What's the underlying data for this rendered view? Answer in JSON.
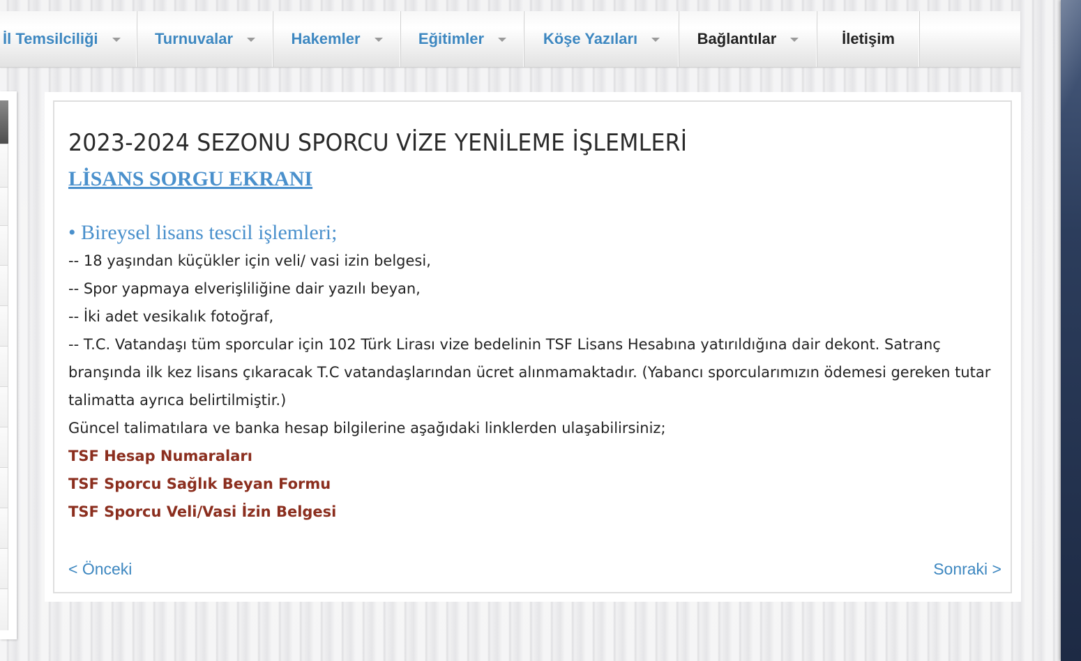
{
  "nav": {
    "items": [
      {
        "label": "İl Temsilciliği",
        "dropdown": true
      },
      {
        "label": "Turnuvalar",
        "dropdown": true
      },
      {
        "label": "Hakemler",
        "dropdown": true
      },
      {
        "label": "Eğitimler",
        "dropdown": true
      },
      {
        "label": "Köşe Yazıları",
        "dropdown": true
      },
      {
        "label": "Bağlantılar",
        "dropdown": true
      },
      {
        "label": "İletişim",
        "dropdown": false
      }
    ]
  },
  "article": {
    "title": "2023-2024 SEZONU SPORCU VİZE YENİLEME İŞLEMLERİ",
    "license_link": "LİSANS SORGU EKRANI",
    "section_heading": "• Bireysel lisans tescil işlemleri;",
    "requirements": [
      "-- 18 yaşından küçükler için veli/ vasi izin belgesi,",
      "-- Spor yapmaya elverişliliğine dair yazılı beyan,",
      "-- İki adet vesikalık fotoğraf,"
    ],
    "fee_paragraph": "-- T.C. Vatandaşı tüm sporcular için 102 Türk Lirası vize bedelinin TSF Lisans Hesabına yatırıldığına dair dekont. Satranç branşında ilk kez lisans çıkaracak T.C vatandaşlarından ücret alınmamaktadır. (Yabancı sporcularımızın ödemesi gereken tutar talimatta ayrıca belirtilmiştir.)",
    "links_intro": "Güncel talimatılara ve banka hesap bilgilerine aşağıdaki linklerden ulaşabilirsiniz;",
    "links": [
      "TSF Hesap Numaraları",
      "TSF Sporcu Sağlık Beyan Formu",
      "TSF Sporcu Veli/Vasi İzin Belgesi"
    ]
  },
  "pager": {
    "prev_label": "< Önceki",
    "next_label": "Sonraki >"
  },
  "colors": {
    "nav_link": "#3d87c0",
    "nav_active": "#222222",
    "heading_blue": "#4a90cc",
    "doc_link": "#8b2e1e",
    "right_panel": "#2c3d5c"
  }
}
